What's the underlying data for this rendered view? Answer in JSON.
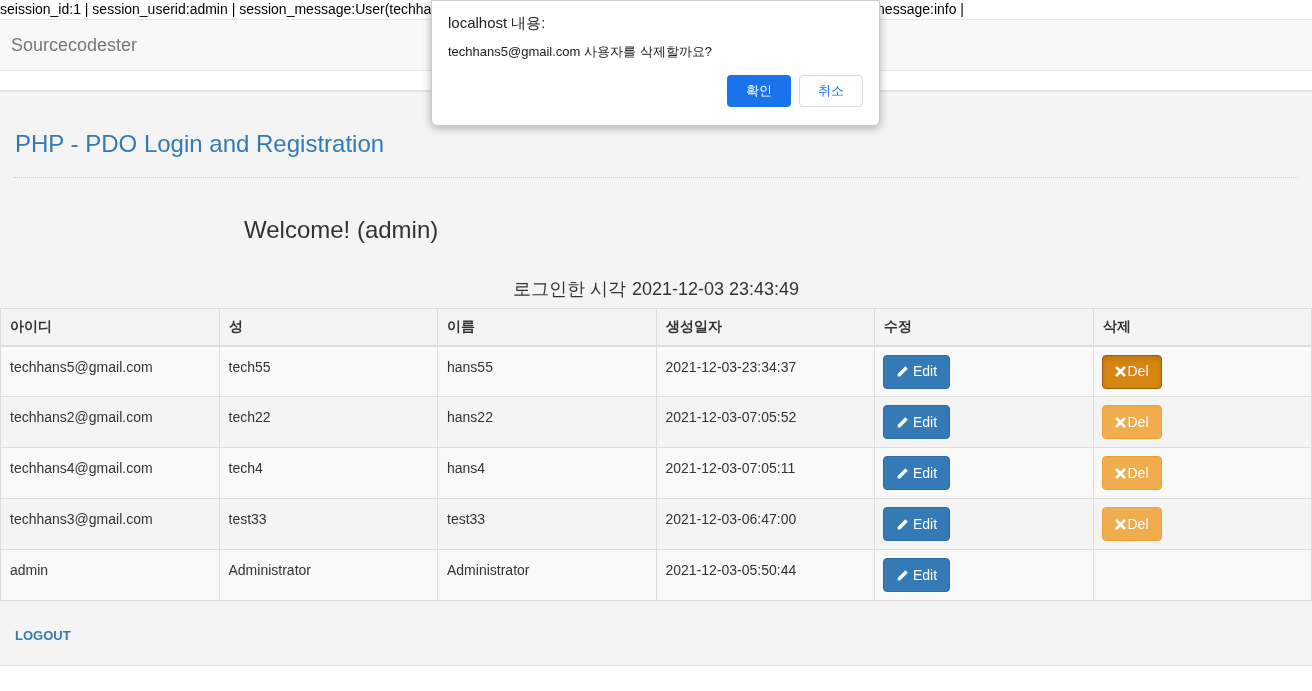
{
  "debug_line": {
    "left": "seission_id:1 | session_userid:admin | session_message:User(techha",
    "right": "nessage:info |"
  },
  "navbar": {
    "brand": "Sourcecodester"
  },
  "page_title": "PHP - PDO Login and Registration",
  "welcome": "Welcome! (admin)",
  "login_time": {
    "label": "로그인한 시각",
    "value": "2021-12-03 23:43:49"
  },
  "table": {
    "columns": [
      "아이디",
      "성",
      "이름",
      "생성일자",
      "수정",
      "삭제"
    ],
    "rows": [
      {
        "cells": [
          "techhans5@gmail.com",
          "tech55",
          "hans55",
          "2021-12-03-23:34:37"
        ],
        "edit": "Edit",
        "delete": {
          "label": "Del",
          "active": true
        }
      },
      {
        "cells": [
          "techhans2@gmail.com",
          "tech22",
          "hans22",
          "2021-12-03-07:05:52"
        ],
        "edit": "Edit",
        "delete": {
          "label": "Del",
          "active": false
        }
      },
      {
        "cells": [
          "techhans4@gmail.com",
          "tech4",
          "hans4",
          "2021-12-03-07:05:11"
        ],
        "edit": "Edit",
        "delete": {
          "label": "Del",
          "active": false
        }
      },
      {
        "cells": [
          "techhans3@gmail.com",
          "test33",
          "test33",
          "2021-12-03-06:47:00"
        ],
        "edit": "Edit",
        "delete": {
          "label": "Del",
          "active": false
        }
      },
      {
        "cells": [
          "admin",
          "Administrator",
          "Administrator",
          "2021-12-03-05:50:44"
        ],
        "edit": "Edit"
      }
    ]
  },
  "logout": "LOGOUT",
  "dialog": {
    "title": "localhost 내용:",
    "message": "techhans5@gmail.com 사용자를 삭제할까요?",
    "buttons": [
      {
        "label": "확인",
        "kind": "primary"
      },
      {
        "label": "취소",
        "kind": "secondary"
      }
    ]
  }
}
